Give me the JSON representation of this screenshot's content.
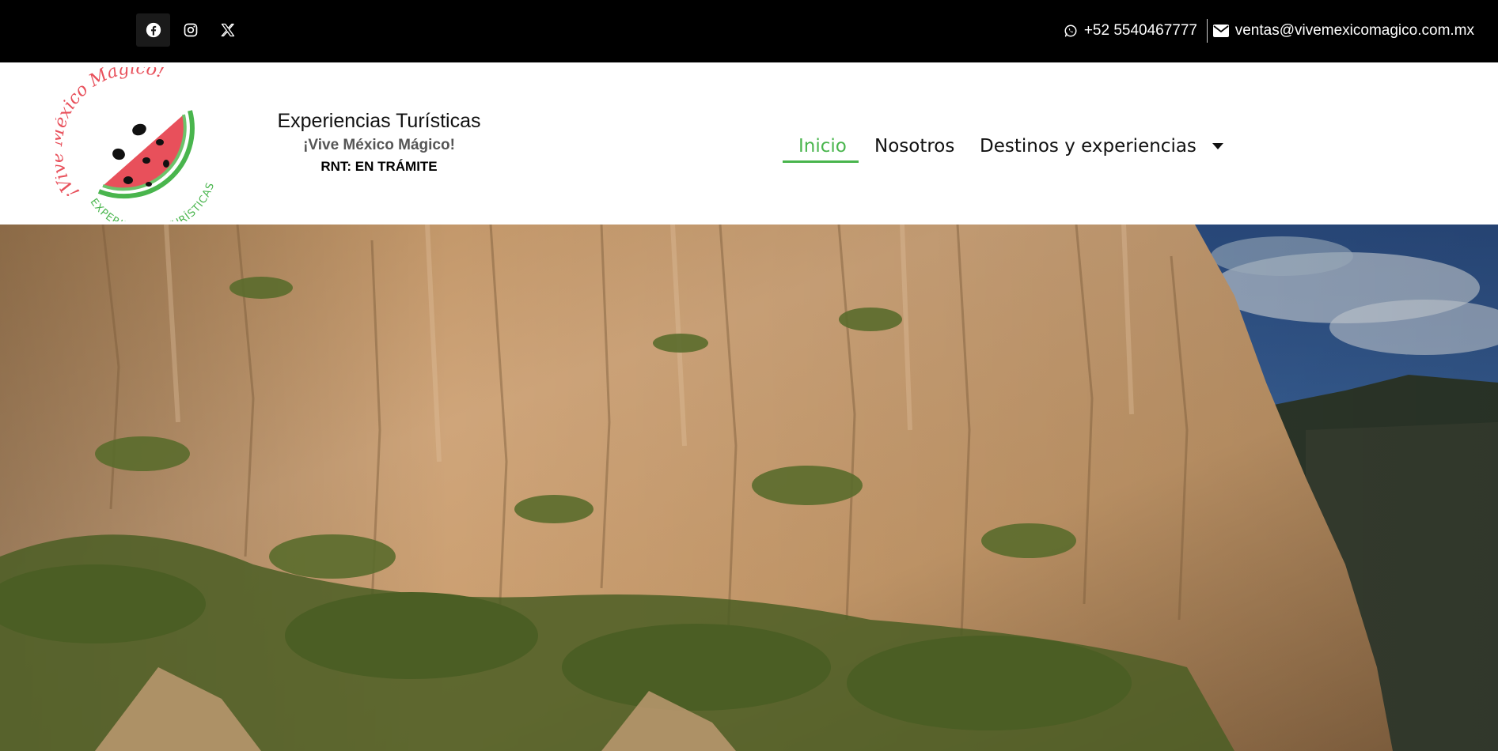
{
  "topbar": {
    "social": [
      {
        "name": "facebook-icon"
      },
      {
        "name": "instagram-icon"
      },
      {
        "name": "x-icon"
      }
    ],
    "phone": "+52 5540467777",
    "email": "ventas@vivemexicomagico.com.mx",
    "phone_icon": "whatsapp-icon",
    "email_icon": "envelope-icon"
  },
  "brand": {
    "title": "Experiencias Turísticas",
    "subtitle": "¡Vive México Mágico!",
    "rnt": "RNT: EN TRÁMITE",
    "logo_text_top": "¡Vive México Mágico!",
    "logo_text_bottom": "EXPERIENCIAS TURÍSTICAS"
  },
  "nav": {
    "items": [
      {
        "label": "Inicio",
        "active": true
      },
      {
        "label": "Nosotros",
        "active": false
      },
      {
        "label": "Destinos y experiencias",
        "active": false,
        "dropdown": true
      }
    ]
  },
  "colors": {
    "accent": "#49b54d",
    "logo_red": "#e8505b",
    "topbar": "#000000"
  },
  "hero": {
    "image": "canyon-cliff-photo"
  }
}
